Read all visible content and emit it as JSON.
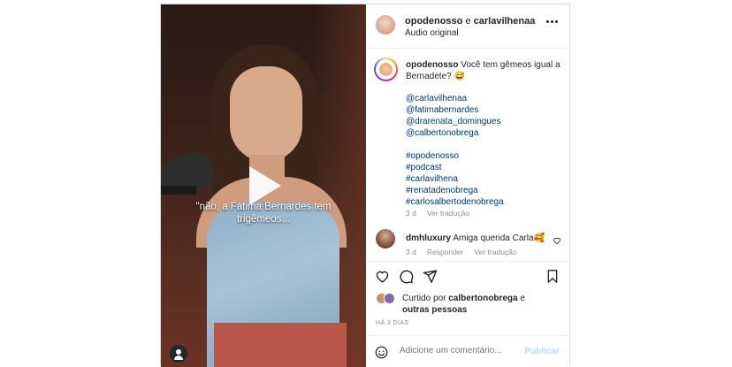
{
  "video": {
    "caption_line1": "\"não, a Fátima Bernardes tem",
    "caption_line2": "trigêmeos..."
  },
  "header": {
    "user1": "opodenosso",
    "separator": "e",
    "user2": "carlavilhenaa",
    "audio": "Áudio original"
  },
  "caption": {
    "username": "opodenosso",
    "text": "Você tem gêmeos igual a Bernadete? 😅",
    "mentions": [
      "@carlavilhenaa",
      "@fatimabernardes",
      "@drarenata_domingues",
      "@calbertonobrega"
    ],
    "hashtags": [
      "#opodenosso",
      "#podcast",
      "#carlavilhena",
      "#renatadenobrega",
      "#carlosalbertodenobrega"
    ],
    "age": "3 d",
    "translate": "Ver tradução"
  },
  "comment": {
    "username": "dmhluxury",
    "text": "Amiga querida Carla🥰",
    "age": "3 d",
    "reply": "Responder",
    "translate": "Ver tradução"
  },
  "likes": {
    "prefix": "Curtido por",
    "user": "calbertonobrega",
    "suffix": "e",
    "others": "outras pessoas"
  },
  "time_ago": "HÁ 3 DIAS",
  "add_comment": {
    "placeholder": "Adicione um comentário...",
    "publish": "Publicar"
  }
}
